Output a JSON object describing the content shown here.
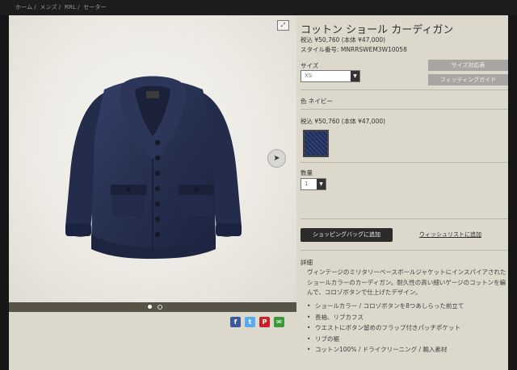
{
  "breadcrumb": [
    "ホーム",
    "/",
    "メンズ",
    "/",
    "RRL",
    "/",
    "セーター"
  ],
  "product": {
    "title": "コットン ショール カーディガン",
    "price": "税込 ¥50,760 (本体 ¥47,000)",
    "style_number": "スタイル番号: MNRRSWEM3W10058"
  },
  "size": {
    "label": "サイズ",
    "selected": "XS",
    "size_chart_button": "サイズ対応表",
    "fitting_guide_button": "フィッティングガイド"
  },
  "color": {
    "label": "色  ネイビー",
    "price": "税込 ¥50,760 (本体 ¥47,000)",
    "swatch_color": "#2a375f"
  },
  "quantity": {
    "label": "数量",
    "selected": "1"
  },
  "actions": {
    "add_to_bag": "ショッピングバッグに追加",
    "add_to_wishlist": "ウィッシュリストに追加"
  },
  "details": {
    "label": "詳細",
    "description": "ヴィンテージのミリタリーベースボールジャケットにインスパイアされたショールカラーのカーディガン。耐久性の高い細いゲージのコットンを編んで、コロゾボタンで仕上げたデザイン。",
    "bullets": [
      "ショールカラー / コロゾボタンを8つあしらった前立て",
      "長袖、リブカフス",
      "ウエストにボタン留めのフラップ付きパッチポケット",
      "リブの裾",
      "コットン100% / ドライクリーニング / 輸入素材"
    ]
  },
  "gallery": {
    "zoom_icon": "expand-icon",
    "next_icon": "arrow-right-icon",
    "dots_total": 2,
    "active_dot": 1
  },
  "share": {
    "facebook": "f",
    "twitter": "t",
    "pinterest": "P",
    "email": "✉"
  },
  "colors": {
    "page_bg": "#dcd8cb",
    "topbar": "#1d1d1d",
    "add_button": "#2b2b2b",
    "side_buttons": "#a7a6a2",
    "garment": "#26304f"
  }
}
